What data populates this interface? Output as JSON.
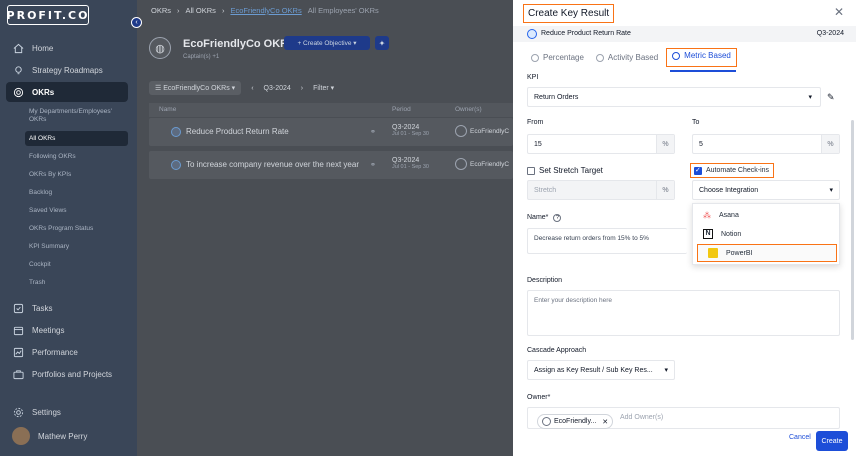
{
  "sidebar": {
    "logo": "PROFIT.CO",
    "items": [
      {
        "label": "Home",
        "icon": "home-icon"
      },
      {
        "label": "Strategy Roadmaps",
        "icon": "bulb-icon"
      },
      {
        "label": "OKRs",
        "icon": "target-icon"
      },
      {
        "label": "Tasks",
        "icon": "checkbox-icon"
      },
      {
        "label": "Meetings",
        "icon": "calendar-icon"
      },
      {
        "label": "Performance",
        "icon": "chart-icon"
      },
      {
        "label": "Portfolios and Projects",
        "icon": "briefcase-icon"
      },
      {
        "label": "Settings",
        "icon": "gear-icon"
      }
    ],
    "sub_items": [
      "My Departments/Employees' OKRs",
      "All OKRs",
      "Following OKRs",
      "OKRs By KPIs",
      "Backlog",
      "Saved Views",
      "OKRs Program Status",
      "KPI Summary",
      "Cockpit",
      "Trash"
    ],
    "user": "Mathew Perry"
  },
  "main": {
    "breadcrumb": [
      "OKRs",
      "All OKRs",
      "EcoFriendlyCo OKRs",
      "All Employees' OKRs"
    ],
    "org_title": "EcoFriendlyCo OKRs",
    "captain_label": "Captain(s)",
    "captain_extra": "+1",
    "create_objective": "+ Create Objective ▾",
    "filter_scope": "☰ EcoFriendlyCo OKRs ▾",
    "period": "Q3-2024",
    "filter": "Filter ▾",
    "columns": [
      "Name",
      "Period",
      "Owner(s)"
    ],
    "rows": [
      {
        "name": "Reduce Product Return Rate",
        "period": "Q3-2024",
        "range": "Jul 01 - Sep 30",
        "owner": "EcoFriendlyC"
      },
      {
        "name": "To increase company revenue over the next year",
        "period": "Q3-2024",
        "range": "Jul 01 - Sep 30",
        "owner": "EcoFriendlyC"
      }
    ]
  },
  "panel": {
    "title": "Create Key Result",
    "context_name": "Reduce Product Return Rate",
    "context_period": "Q3-2024",
    "tabs": [
      "Percentage",
      "Activity Based",
      "Metric Based"
    ],
    "kpi_label": "KPI",
    "kpi_value": "Return Orders",
    "from_label": "From",
    "from_value": "15",
    "to_label": "To",
    "to_value": "5",
    "pct": "%",
    "stretch_label": "Set Stretch Target",
    "stretch_placeholder": "Stretch",
    "automate_label": "Automate Check-ins",
    "integration_placeholder": "Choose Integration",
    "integrations": [
      "Asana",
      "Notion",
      "PowerBI"
    ],
    "name_label": "Name*",
    "name_value": "Decrease return orders from 15% to 5%",
    "description_label": "Description",
    "description_placeholder": "Enter your description here",
    "cascade_label": "Cascade Approach",
    "cascade_value": "Assign as Key Result / Sub Key Res...",
    "owner_label": "Owner*",
    "owner_chip": "EcoFriendly...",
    "owner_placeholder": "Add Owner(s)",
    "cancel": "Cancel",
    "create": "Create"
  }
}
